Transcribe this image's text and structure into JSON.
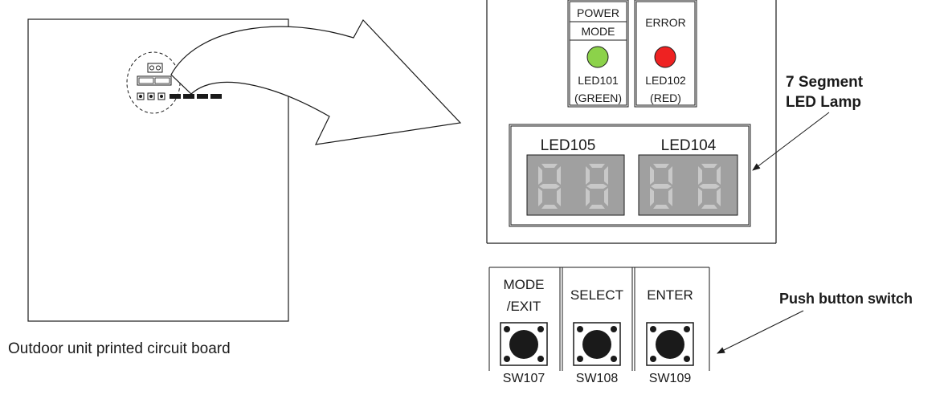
{
  "pcb": {
    "caption": "Outdoor unit printed circuit board"
  },
  "indicators": {
    "power": {
      "label_top": "POWER",
      "label_bottom": "MODE",
      "led_id": "LED101",
      "color_name": "(GREEN)",
      "color": "#8cd24a"
    },
    "error": {
      "label": "ERROR",
      "led_id": "LED102",
      "color_name": "(RED)",
      "color": "#ee2222"
    }
  },
  "displays": [
    {
      "label": "LED105"
    },
    {
      "label": "LED104"
    }
  ],
  "segment_callout": {
    "line1": "7 Segment",
    "line2": "LED Lamp"
  },
  "buttons": [
    {
      "label_line1": "MODE",
      "label_line2": "/EXIT",
      "switch_id": "SW107"
    },
    {
      "label_line1": "",
      "label_line2": "SELECT",
      "switch_id": "SW108"
    },
    {
      "label_line1": "",
      "label_line2": "ENTER",
      "switch_id": "SW109"
    }
  ],
  "button_callout": {
    "label": "Push button switch"
  },
  "colors": {
    "display_bg": "#a0a0a0",
    "segment": "#c8c8c8",
    "outline": "#1a1a1a"
  }
}
